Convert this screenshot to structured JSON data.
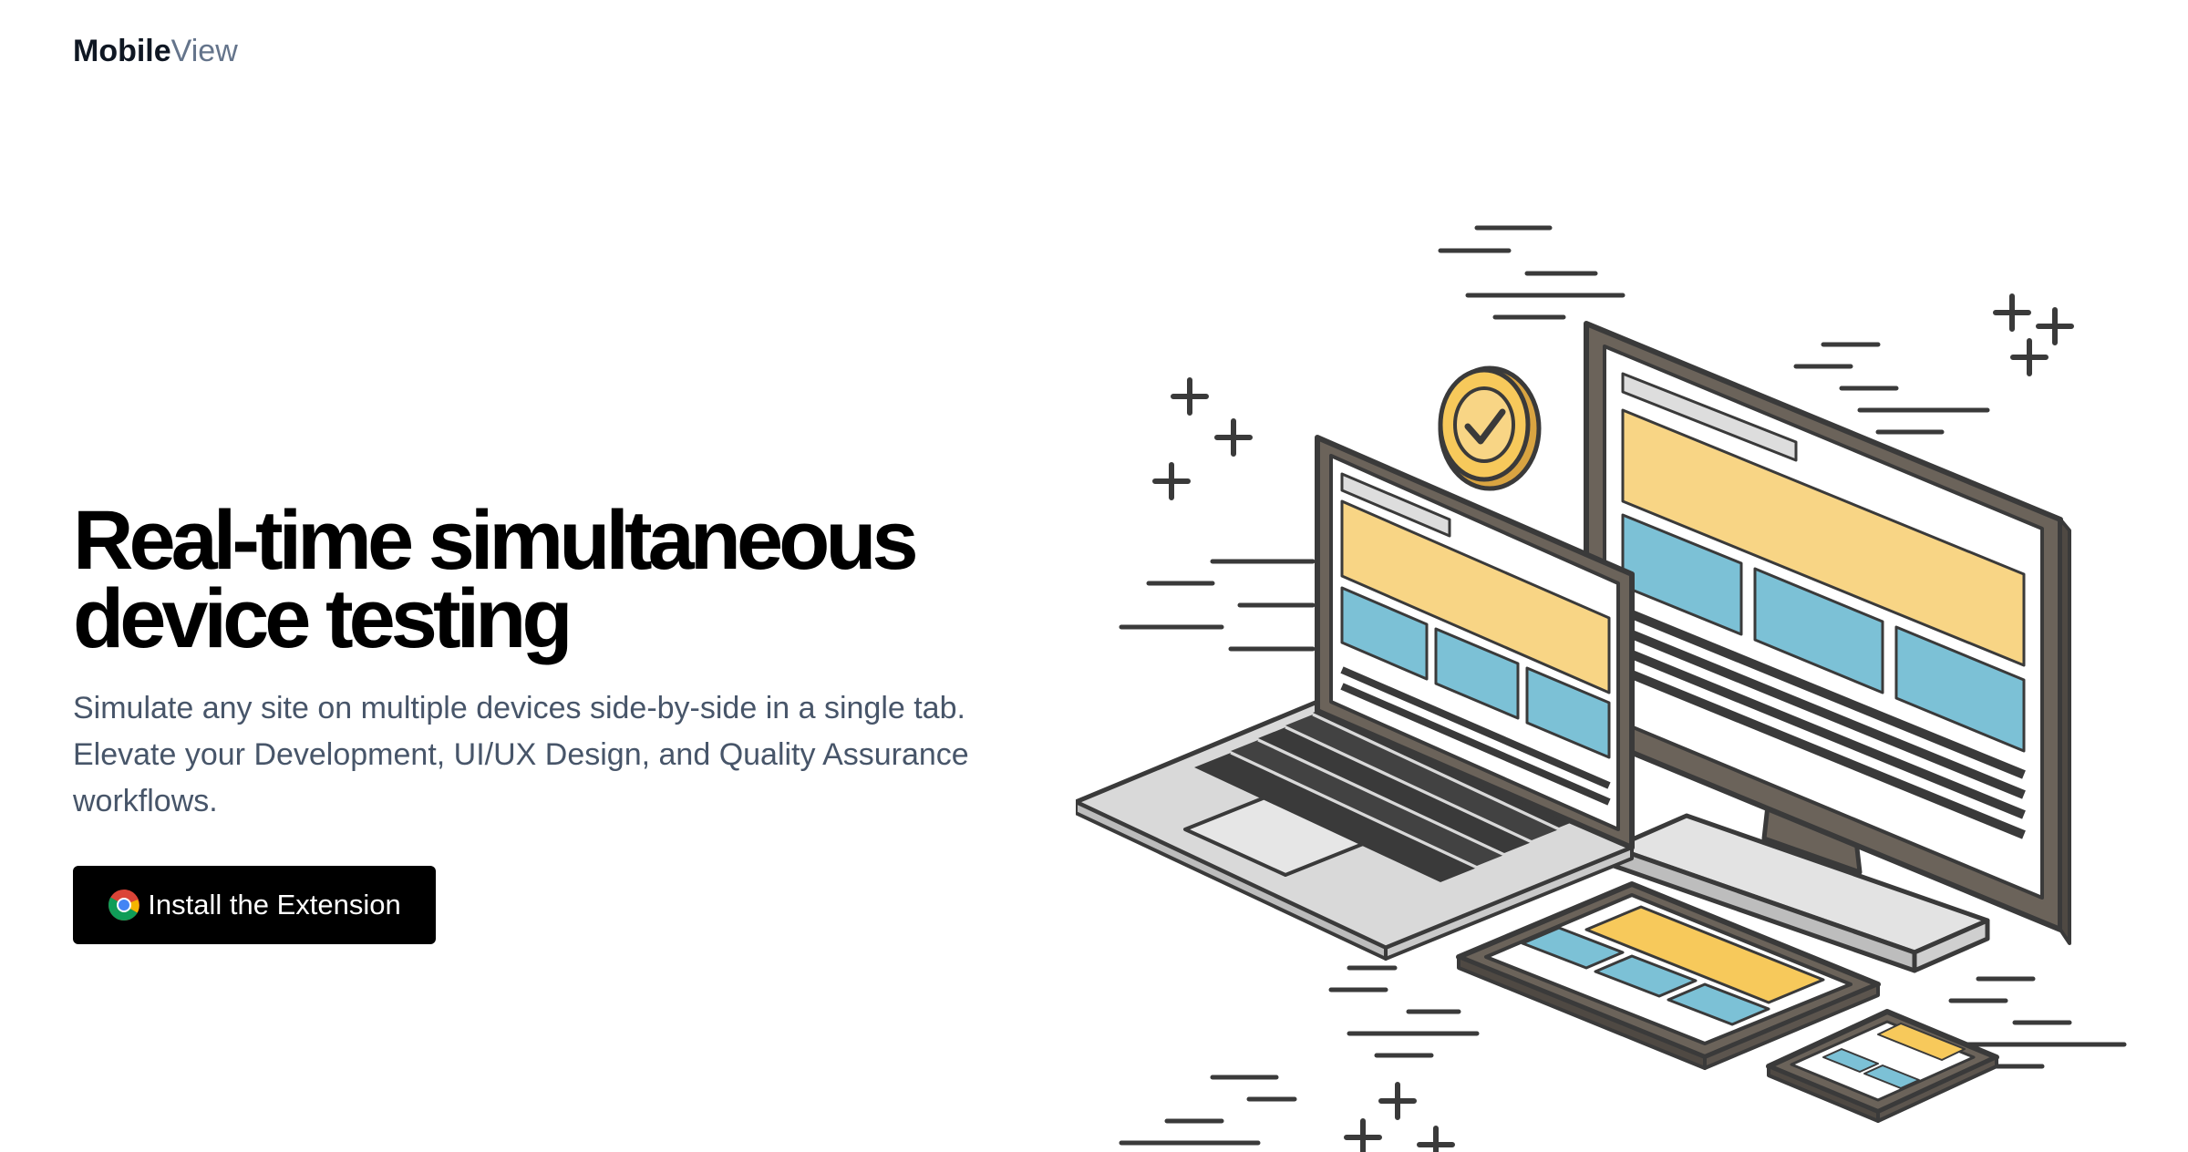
{
  "header": {
    "logo_bold": "Mobile",
    "logo_light": "View"
  },
  "hero": {
    "title_line1": "Real-time simultaneous",
    "title_line2": "device testing",
    "description": "Simulate any site on multiple devices side-by-side in a single tab. Elevate your Development, UI/UX Design, and Quality Assurance workflows.",
    "cta_label": "Install the Extension",
    "cta_icon": "chrome-icon"
  },
  "colors": {
    "cta_background": "#000000",
    "illustration_yellow": "#f8d585",
    "illustration_blue": "#7cc1d6",
    "illustration_stroke": "#3a3a3a"
  }
}
